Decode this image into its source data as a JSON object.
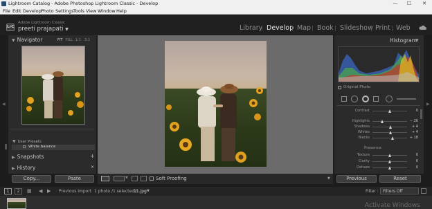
{
  "title_bar": {
    "title": "Lightroom Catalog - Adobe Photoshop Lightroom Classic - Develop",
    "min": "—",
    "max": "☐",
    "close": "✕"
  },
  "menu": [
    "File",
    "Edit",
    "Develop",
    "Photo",
    "Settings",
    "Tools",
    "View",
    "Window",
    "Help"
  ],
  "identity": {
    "badge": "LrC",
    "app_name": "Adobe Lightroom Classic",
    "user": "preeti prajapati"
  },
  "modules": [
    "Library",
    "Develop",
    "Map",
    "Book",
    "Slideshow",
    "Print",
    "Web"
  ],
  "active_module": "Develop",
  "left_panel": {
    "navigator": {
      "title": "Navigator",
      "zoom_options": [
        "FIT",
        "FILL",
        "1:1",
        "3:1"
      ]
    },
    "presets": {
      "group": "User Presets",
      "item": "White balance"
    },
    "snapshots": {
      "title": "Snapshots",
      "add": "+"
    },
    "history": {
      "title": "History",
      "clear": "✕"
    },
    "copy_button": "Copy...",
    "paste_button": "Paste"
  },
  "toolbar": {
    "soft_proofing": "Soft Proofing"
  },
  "right_panel": {
    "histogram_title": "Histogram",
    "original_photo": "Original Photo",
    "sliders": [
      {
        "label": "Contrast",
        "value": "0"
      },
      {
        "label": "Highlights",
        "value": "− 26"
      },
      {
        "label": "Shadows",
        "value": "+ 4"
      },
      {
        "label": "Whites",
        "value": "+ 4"
      },
      {
        "label": "Blacks",
        "value": "+ 18"
      }
    ],
    "presence_title": "Presence",
    "presence_sliders": [
      {
        "label": "Texture",
        "value": "0"
      },
      {
        "label": "Clarity",
        "value": "0"
      },
      {
        "label": "Dehaze",
        "value": "0"
      }
    ],
    "previous_button": "Previous",
    "reset_button": "Reset"
  },
  "filmstrip_bar": {
    "screen1": "1",
    "screen2": "2",
    "previous_import": "Previous Import",
    "selection": "1 photo /1 selected /",
    "filename": "11.jpg",
    "filter_label": "Filter :",
    "filter_value": "Filters Off"
  },
  "watermark": "Activate Windows"
}
